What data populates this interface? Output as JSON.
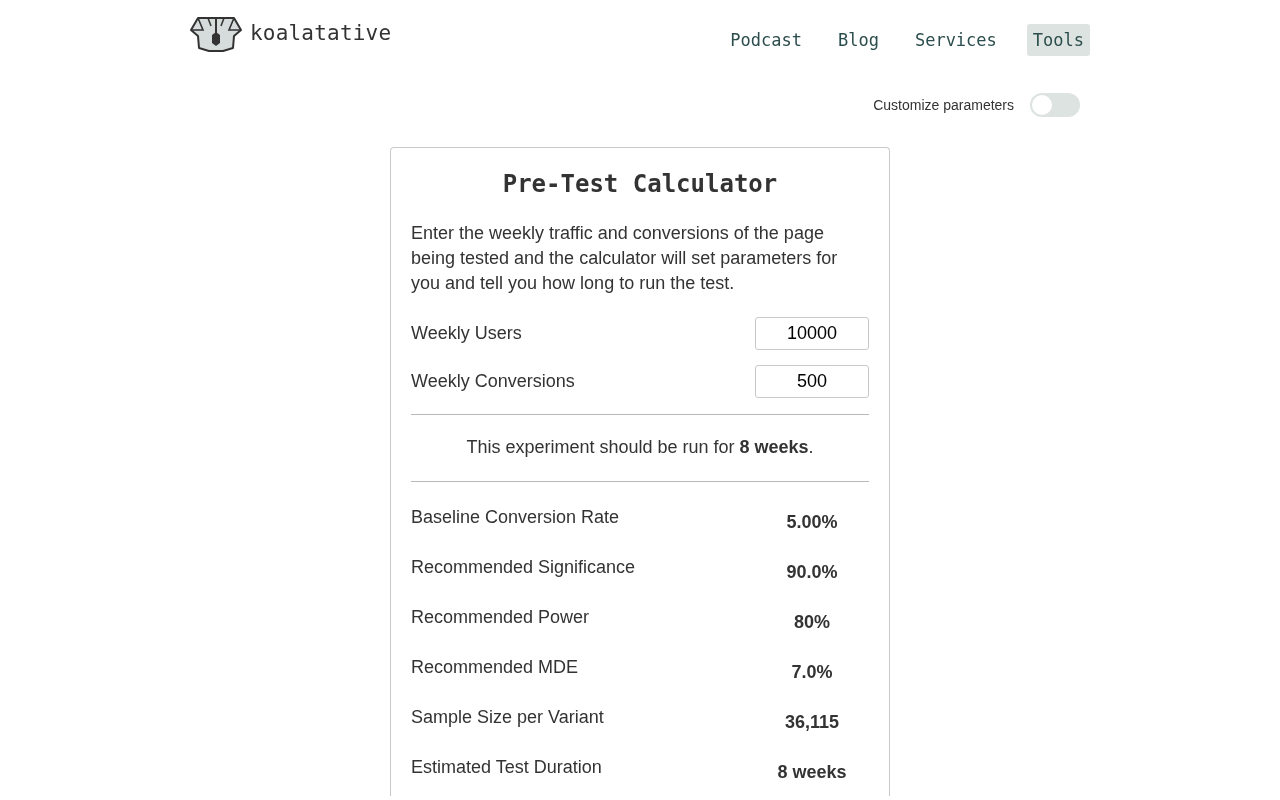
{
  "brand": {
    "name": "koalatative"
  },
  "nav": [
    {
      "label": "Podcast",
      "selected": false
    },
    {
      "label": "Blog",
      "selected": false
    },
    {
      "label": "Services",
      "selected": false
    },
    {
      "label": "Tools",
      "selected": true
    }
  ],
  "customize_toggle": {
    "label": "Customize parameters",
    "on": false
  },
  "calculator": {
    "title": "Pre-Test Calculator",
    "intro": "Enter the weekly traffic and conversions of the page being tested and the calculator will set parameters for you and tell you how long to run the test.",
    "fields": [
      {
        "label": "Weekly Users",
        "value": "10000"
      },
      {
        "label": "Weekly Conversions",
        "value": "500"
      }
    ],
    "summary": "This experiment should be run for **8 weeks**.",
    "results": [
      {
        "label": "Baseline Conversion Rate",
        "value": "5.00%"
      },
      {
        "label": "Recommended Significance",
        "value": "90.0%"
      },
      {
        "label": "Recommended Power",
        "value": "80%"
      },
      {
        "label": "Recommended MDE",
        "value": "7.0%"
      },
      {
        "label": "Sample Size per Variant",
        "value": "36,115"
      },
      {
        "label": "Estimated Test Duration",
        "value": "8 weeks"
      }
    ]
  }
}
